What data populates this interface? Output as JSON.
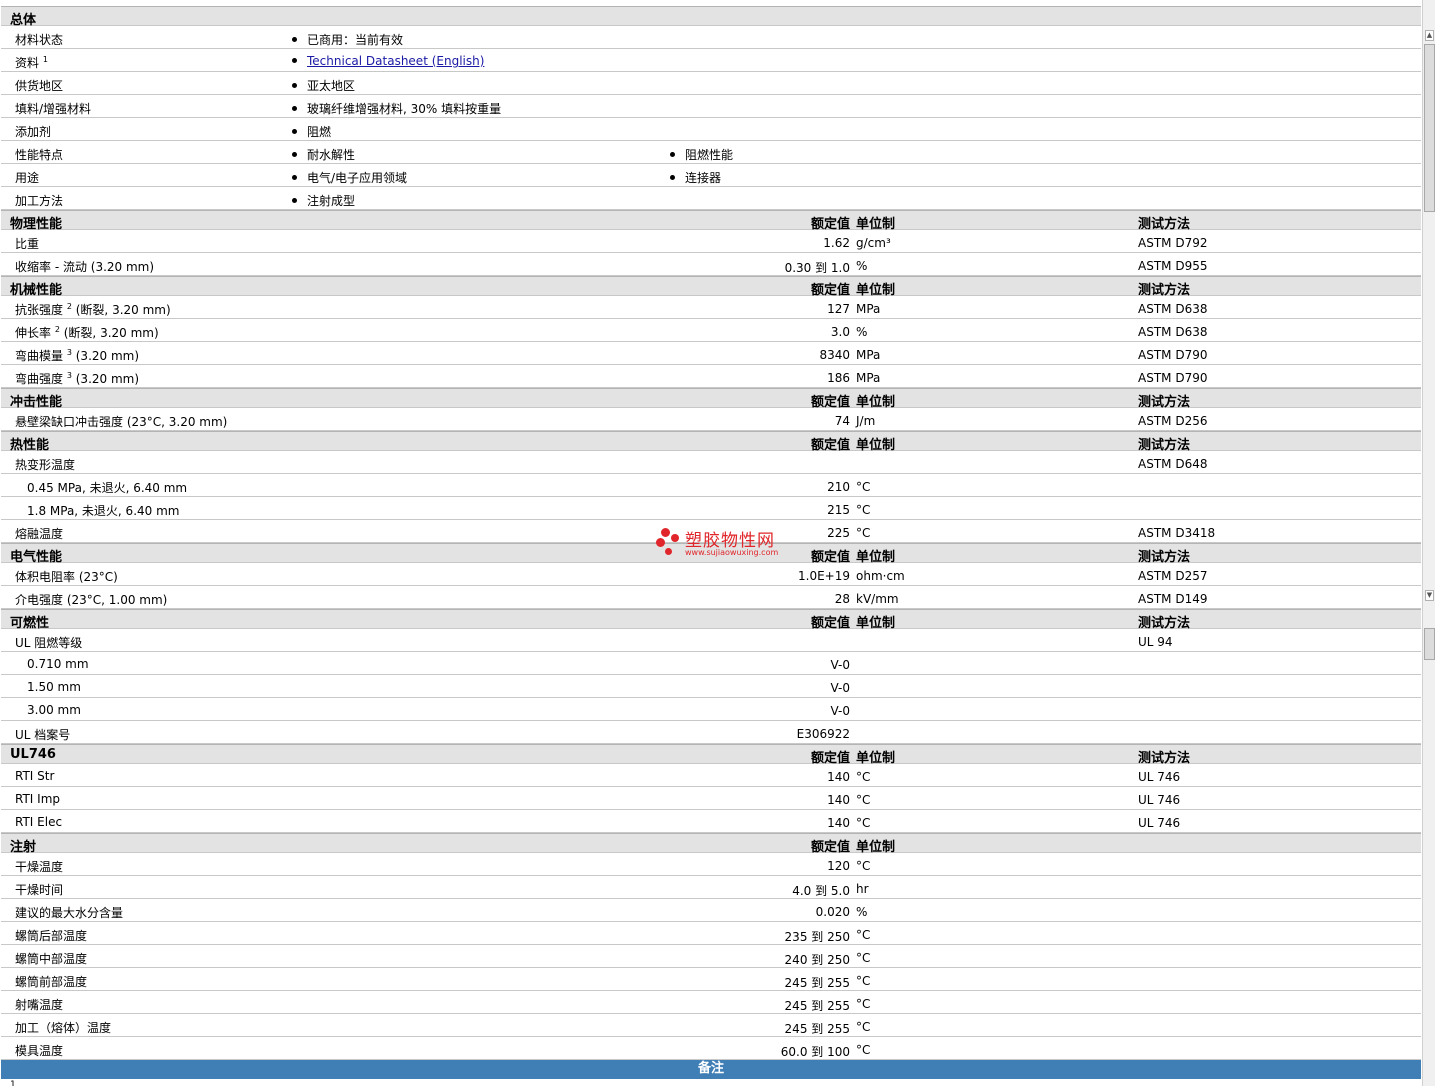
{
  "general": {
    "title": "总体",
    "rows": [
      {
        "label": "材料状态",
        "items": [
          "已商用：当前有效"
        ]
      },
      {
        "label": "资料",
        "sup": "1",
        "items": [],
        "link": "Technical Datasheet (English)"
      },
      {
        "label": "供货地区",
        "items": [
          "亚太地区"
        ]
      },
      {
        "label": "填料/增强材料",
        "items": [
          "玻璃纤维增强材料, 30% 填料按重量"
        ]
      },
      {
        "label": "添加剂",
        "items": [
          "阻燃"
        ]
      },
      {
        "label": "性能特点",
        "items": [
          "耐水解性",
          "阻燃性能"
        ]
      },
      {
        "label": "用途",
        "items": [
          "电气/电子应用领域",
          "连接器"
        ]
      },
      {
        "label": "加工方法",
        "items": [
          "注射成型"
        ]
      }
    ]
  },
  "column_headers": {
    "value": "额定值",
    "unit": "单位制",
    "test": "测试方法"
  },
  "sections": [
    {
      "title": "物理性能",
      "show_test": true,
      "rows": [
        {
          "label": "比重",
          "value": "1.62",
          "unit": "g/cm³",
          "test": "ASTM D792"
        },
        {
          "label": "收缩率 - 流动 (3.20 mm)",
          "value": "0.30 到  1.0",
          "unit": "%",
          "test": "ASTM D955"
        }
      ]
    },
    {
      "title": "机械性能",
      "show_test": true,
      "rows": [
        {
          "label": "抗张强度",
          "sup": "2",
          "suffix": " (断裂, 3.20 mm)",
          "value": "127",
          "unit": "MPa",
          "test": "ASTM D638"
        },
        {
          "label": "伸长率",
          "sup": "2",
          "suffix": " (断裂, 3.20 mm)",
          "value": "3.0",
          "unit": "%",
          "test": "ASTM D638"
        },
        {
          "label": "弯曲模量",
          "sup": "3",
          "suffix": " (3.20 mm)",
          "value": "8340",
          "unit": "MPa",
          "test": "ASTM D790"
        },
        {
          "label": "弯曲强度",
          "sup": "3",
          "suffix": " (3.20 mm)",
          "value": "186",
          "unit": "MPa",
          "test": "ASTM D790"
        }
      ]
    },
    {
      "title": "冲击性能",
      "show_test": true,
      "rows": [
        {
          "label": "悬壁梁缺口冲击强度 (23°C, 3.20 mm)",
          "value": "74",
          "unit": "J/m",
          "test": "ASTM D256"
        }
      ]
    },
    {
      "title": "热性能",
      "show_test": true,
      "rows": [
        {
          "label": "热变形温度",
          "value": "",
          "unit": "",
          "test": "ASTM D648"
        },
        {
          "label": "0.45 MPa, 未退火, 6.40 mm",
          "sub": true,
          "value": "210",
          "unit": "°C",
          "test": ""
        },
        {
          "label": "1.8 MPa, 未退火, 6.40 mm",
          "sub": true,
          "value": "215",
          "unit": "°C",
          "test": ""
        },
        {
          "label": "熔融温度",
          "value": "225",
          "unit": "°C",
          "test": "ASTM D3418"
        }
      ]
    },
    {
      "title": "电气性能",
      "show_test": true,
      "rows": [
        {
          "label": "体积电阻率 (23°C)",
          "value": "1.0E+19",
          "unit": "ohm·cm",
          "test": "ASTM D257"
        },
        {
          "label": "介电强度 (23°C, 1.00 mm)",
          "value": "28",
          "unit": "kV/mm",
          "test": "ASTM D149"
        }
      ]
    },
    {
      "title": "可燃性",
      "show_test": true,
      "rows": [
        {
          "label": "UL 阻燃等级",
          "value": "",
          "unit": "",
          "test": "UL 94"
        },
        {
          "label": "0.710 mm",
          "sub": true,
          "value": "V-0",
          "unit": "",
          "test": ""
        },
        {
          "label": "1.50 mm",
          "sub": true,
          "value": "V-0",
          "unit": "",
          "test": ""
        },
        {
          "label": "3.00 mm",
          "sub": true,
          "value": "V-0",
          "unit": "",
          "test": ""
        },
        {
          "label": "UL 档案号",
          "value": "E306922",
          "unit": "",
          "test": ""
        }
      ]
    },
    {
      "title": "UL746",
      "show_test": true,
      "rows": [
        {
          "label": "RTI Str",
          "value": "140",
          "unit": "°C",
          "test": "UL 746"
        },
        {
          "label": "RTI Imp",
          "value": "140",
          "unit": "°C",
          "test": "UL 746"
        },
        {
          "label": "RTI Elec",
          "value": "140",
          "unit": "°C",
          "test": "UL 746"
        }
      ]
    },
    {
      "title": "注射",
      "show_test": false,
      "rows": [
        {
          "label": "干燥温度",
          "value": "120",
          "unit": "°C",
          "test": ""
        },
        {
          "label": "干燥时间",
          "value": "4.0 到  5.0",
          "unit": "hr",
          "test": ""
        },
        {
          "label": "建议的最大水分含量",
          "value": "0.020",
          "unit": "%",
          "test": ""
        },
        {
          "label": "螺筒后部温度",
          "value": "235 到  250",
          "unit": "°C",
          "test": ""
        },
        {
          "label": "螺筒中部温度",
          "value": "240 到  250",
          "unit": "°C",
          "test": ""
        },
        {
          "label": "螺筒前部温度",
          "value": "245 到  255",
          "unit": "°C",
          "test": ""
        },
        {
          "label": "射嘴温度",
          "value": "245 到  255",
          "unit": "°C",
          "test": ""
        },
        {
          "label": "加工（熔体）温度",
          "value": "245 到  255",
          "unit": "°C",
          "test": ""
        },
        {
          "label": "模具温度",
          "value": "60.0 到  100",
          "unit": "°C",
          "test": ""
        }
      ]
    }
  ],
  "notes": {
    "title": "备注",
    "footnote_marker": "1"
  },
  "watermark": {
    "title": "塑胶物性网",
    "url": "www.sujiaowuxing.com"
  }
}
